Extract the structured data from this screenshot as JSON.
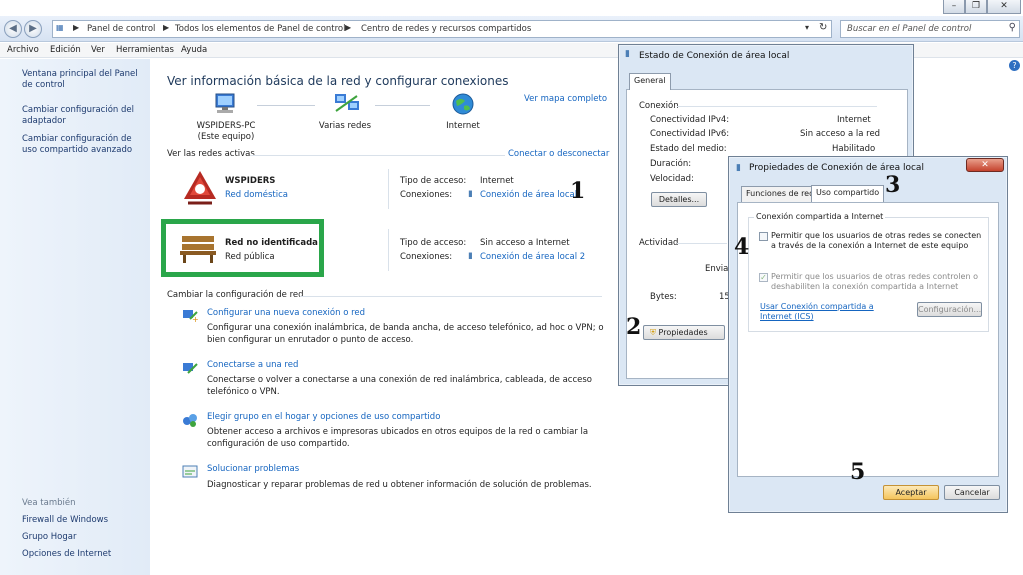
{
  "address_bar": {
    "breadcrumb": [
      "Panel de control",
      "Todos los elementos de Panel de control",
      "Centro de redes y recursos compartidos"
    ],
    "search_placeholder": "Buscar en el Panel de control"
  },
  "menu": [
    "Archivo",
    "Edición",
    "Ver",
    "Herramientas",
    "Ayuda"
  ],
  "left_pane": {
    "links": [
      "Ventana principal del Panel de control",
      "Cambiar configuración del adaptador",
      "Cambiar configuración de uso compartido avanzado"
    ],
    "see_also_heading": "Vea también",
    "see_also": [
      "Firewall de Windows",
      "Grupo Hogar",
      "Opciones de Internet"
    ]
  },
  "main": {
    "title": "Ver información básica de la red y configurar conexiones",
    "full_map": "Ver mapa completo",
    "map_nodes": [
      "WSPIDERS-PC",
      "Varias redes",
      "Internet"
    ],
    "this_computer": "(Este equipo)",
    "active_networks": "Ver las redes activas",
    "connect_disconnect": "Conectar o desconectar",
    "access_type_label": "Tipo de acceso:",
    "connections_label": "Conexiones:",
    "networks": [
      {
        "name": "WSPIDERS",
        "category": "Red doméstica",
        "access": "Internet",
        "connection": "Conexión de área local"
      },
      {
        "name": "Red no identificada",
        "category": "Red pública",
        "access": "Sin acceso a Internet",
        "connection": "Conexión de área local 2"
      }
    ],
    "change_settings": "Cambiar la configuración de red",
    "tasks": [
      {
        "title": "Configurar una nueva conexión o red",
        "desc": "Configurar una conexión inalámbrica, de banda ancha, de acceso telefónico, ad hoc o VPN; o bien configurar un enrutador o punto de acceso."
      },
      {
        "title": "Conectarse a una red",
        "desc": "Conectarse o volver a conectarse a una conexión de red inalámbrica, cableada, de acceso telefónico o VPN."
      },
      {
        "title": "Elegir grupo en el hogar y opciones de uso compartido",
        "desc": "Obtener acceso a archivos e impresoras ubicados en otros equipos de la red o cambiar la configuración de uso compartido."
      },
      {
        "title": "Solucionar problemas",
        "desc": "Diagnosticar y reparar problemas de red u obtener información de solución de problemas."
      }
    ]
  },
  "status_dialog": {
    "title": "Estado de Conexión de área local",
    "tab": "General",
    "section_connection": "Conexión",
    "rows": [
      {
        "label": "Conectividad IPv4:",
        "value": "Internet"
      },
      {
        "label": "Conectividad IPv6:",
        "value": "Sin acceso a la red"
      },
      {
        "label": "Estado del medio:",
        "value": "Habilitado"
      },
      {
        "label": "Duración:",
        "value": ""
      },
      {
        "label": "Velocidad:",
        "value": ""
      }
    ],
    "details_button": "Detalles...",
    "section_activity": "Actividad",
    "sent_partial": "Envia",
    "bytes_label": "Bytes:",
    "bytes_partial": "15",
    "properties_button": "Propiedades"
  },
  "props_dialog": {
    "title": "Propiedades de Conexión de área local",
    "tabs": [
      "Funciones de red",
      "Uso compartido"
    ],
    "group_title": "Conexión compartida a Internet",
    "check1": "Permitir que los usuarios de otras redes se conecten a través de la conexión a Internet de este equipo",
    "check2": "Permitir que los usuarios de otras redes controlen o deshabiliten la conexión compartida a Internet",
    "ics_link": "Usar Conexión compartida a Internet (ICS)",
    "config_button": "Configuración...",
    "ok_button": "Aceptar",
    "cancel_button": "Cancelar"
  },
  "annotations": [
    "1",
    "2",
    "3",
    "4",
    "5"
  ],
  "colors": {
    "highlight_frame": "#2aa64a",
    "link": "#1565c0"
  }
}
